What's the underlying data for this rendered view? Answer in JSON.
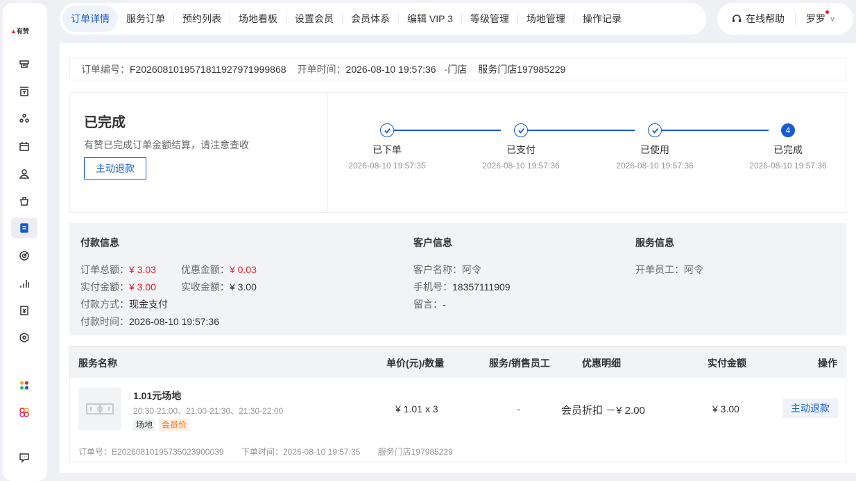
{
  "logo": {
    "text": "有赞"
  },
  "sidebar": {
    "icons": [
      "store-icon",
      "shop-icon",
      "goods-icon",
      "calendar-icon",
      "customer-icon",
      "bag-icon",
      "order-icon",
      "marketing-icon",
      "data-icon",
      "finance-icon",
      "settings-icon",
      "apps-icon",
      "plugins-icon",
      "chat-icon"
    ]
  },
  "tabs": [
    {
      "label": "订单详情",
      "active": true
    },
    {
      "label": "服务订单"
    },
    {
      "label": "预约列表"
    },
    {
      "label": "场地看板"
    },
    {
      "label": "设置会员"
    },
    {
      "label": "会员体系"
    },
    {
      "label": "编辑 VIP 3"
    },
    {
      "label": "等级管理"
    },
    {
      "label": "场地管理"
    },
    {
      "label": "操作记录"
    }
  ],
  "header": {
    "help": "在线帮助",
    "user": "罗罗"
  },
  "order": {
    "no_label": "订单编号：",
    "no": "F2026081019571811927971999868",
    "time_label": "开单时间：",
    "time": "2026-08-10 19:57:36",
    "channel": "·门店",
    "store": "服务门店197985229"
  },
  "status": {
    "title": "已完成",
    "desc": "有赞已完成订单金额结算，请注意查收",
    "refund_button": "主动退款",
    "steps": [
      {
        "name": "已下单",
        "time": "2026-08-10 19:57:35"
      },
      {
        "name": "已支付",
        "time": "2026-08-10 19:57:36"
      },
      {
        "name": "已使用",
        "time": "2026-08-10 19:57:36"
      },
      {
        "name": "已完成",
        "time": "2026-08-10 19:57:36",
        "num": "4"
      }
    ]
  },
  "payment": {
    "title": "付款信息",
    "total_label": "订单总额：",
    "total": "¥ 3.03",
    "discount_label": "优惠金额：",
    "discount": "¥ 0.03",
    "paid_label": "实付金额：",
    "paid": "¥ 3.00",
    "received_label": "实收金额：",
    "received": "¥ 3.00",
    "method_label": "付款方式：",
    "method": "现金支付",
    "time_label": "付款时间：",
    "time": "2026-08-10 19:57:36"
  },
  "customer": {
    "title": "客户信息",
    "name_label": "客户名称：",
    "name": "阿令",
    "phone_label": "手机号：",
    "phone": "18357111909",
    "note_label": "留言：",
    "note": "-"
  },
  "service": {
    "title": "服务信息",
    "staff_label": "开单员工：",
    "staff": "阿令"
  },
  "table": {
    "headers": {
      "name": "服务名称",
      "price": "单价(元)/数量",
      "staff": "服务/销售员工",
      "discount": "优惠明细",
      "paid": "实付金额",
      "action": "操作"
    },
    "row": {
      "name": "1.01元场地",
      "times": "20:30-21:00、21:00-21:30、21:30-22:00",
      "tag1": "场地",
      "tag2": "会员价",
      "price": "¥ 1.01 x 3",
      "staff": "-",
      "discount": "会员折扣 －¥ 2.00",
      "paid": "¥ 3.00",
      "action": "主动退款"
    },
    "footer": {
      "order_no": "订单号：E20260810195735023900039",
      "order_time": "下单时间：2026-08-10 19:57:35",
      "store": "服务门店197985229"
    }
  }
}
